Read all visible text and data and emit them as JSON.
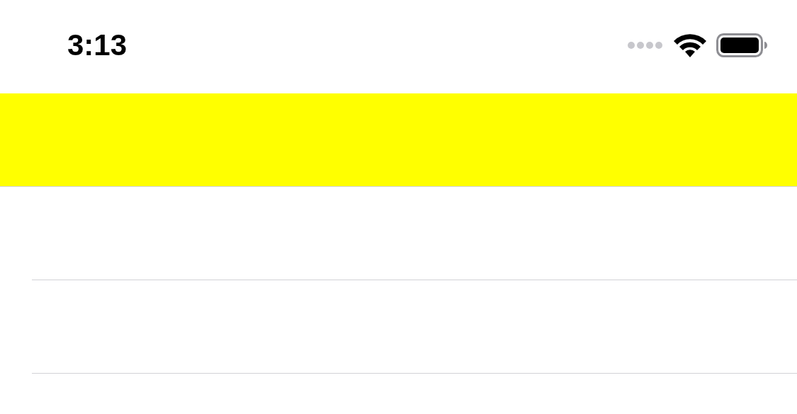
{
  "status_bar": {
    "time": "3:13"
  }
}
